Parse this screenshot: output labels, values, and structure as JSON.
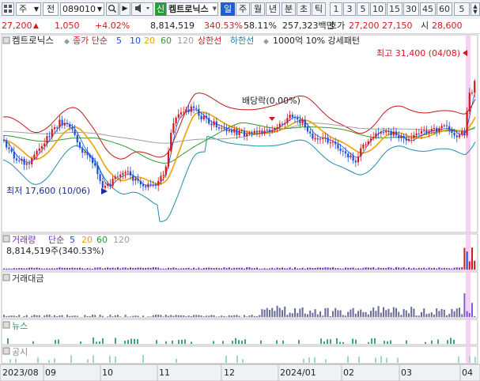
{
  "toolbar": {
    "menu_icon": "grid-icon",
    "type_select": "주",
    "prev_label": "전",
    "code_value": "089010",
    "search_icon": "search-icon",
    "sound_icon": "speaker-icon",
    "new_label": "신",
    "stock_name": "켐트로닉스",
    "periods": [
      "일",
      "주",
      "월",
      "년",
      "분",
      "초",
      "틱"
    ],
    "intervals": [
      "1",
      "3",
      "5",
      "10",
      "15",
      "30",
      "45",
      "60",
      "5"
    ]
  },
  "quote": {
    "price": "27,200",
    "change": "1,050",
    "change_pct": "+4.02%",
    "volume": "8,814,519",
    "volume_ratio": "340.53%",
    "turnover": "58.11%",
    "amount": "257,323백만",
    "ask_label": "호가",
    "ask": "27,200",
    "bid": "27,150",
    "open_label": "시",
    "open": "28,600"
  },
  "main_chart": {
    "title": "켐트로닉스",
    "legend_close": "종가 단순",
    "ma": [
      "5",
      "10",
      "20",
      "60",
      "120"
    ],
    "ma_colors": [
      "#1f4fd8",
      "#1f4fd8",
      "#f0a000",
      "#2e9a2e",
      "#9e9e9e"
    ],
    "upper_label": "상한선",
    "lower_label": "하한선",
    "pattern": "1000억 10% 강세패턴",
    "high_note": "최고 31,400 (04/08)",
    "low_note": "최저 17,600 (10/06)",
    "dividend_note": "배당락(0.00%)"
  },
  "volume_panel": {
    "title": "거래량",
    "legend": "단순",
    "ma": [
      "5",
      "20",
      "60",
      "120"
    ],
    "value": "8,814,519주(340.53%)"
  },
  "amount_panel": {
    "title": "거래대금"
  },
  "news_panel": {
    "title": "뉴스"
  },
  "disclosure_panel": {
    "title": "공시"
  },
  "xaxis": [
    "2023/08",
    "09",
    "10",
    "11",
    "12",
    "2024/01",
    "02",
    "03",
    "04"
  ],
  "chart_data": {
    "type": "candlestick",
    "high": 31400,
    "high_date": "04/08",
    "low": 17600,
    "low_date": "10/06",
    "moving_averages": [
      "5",
      "10",
      "20",
      "60",
      "120"
    ]
  }
}
